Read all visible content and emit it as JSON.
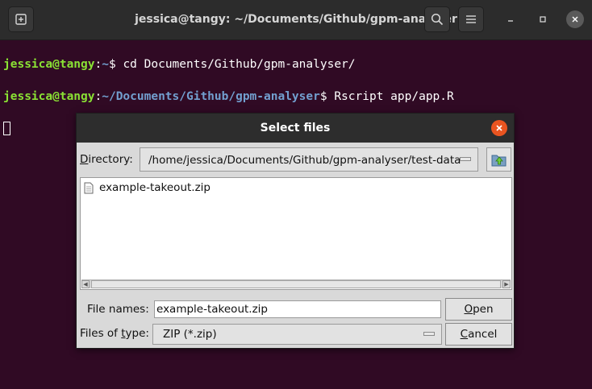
{
  "terminal": {
    "title": "jessica@tangy: ~/Documents/Github/gpm-analyser",
    "lines": [
      {
        "user": "jessica@tangy",
        "sep": ":",
        "path": "~",
        "prompt": "$ ",
        "command": "cd Documents/Github/gpm-analyser/"
      },
      {
        "user": "jessica@tangy",
        "sep": ":",
        "path": "~/Documents/Github/gpm-analyser",
        "prompt": "$ ",
        "command": "Rscript app/app.R"
      }
    ],
    "icons": {
      "new_tab": "new-tab-icon",
      "search": "search-icon",
      "menu": "hamburger-menu-icon",
      "minimize": "minimize-icon",
      "maximize": "maximize-icon",
      "close": "close-icon"
    }
  },
  "dialog": {
    "title": "Select files",
    "directory_label_prefix": "D",
    "directory_label_rest": "irectory:",
    "directory_value": "/home/jessica/Documents/Github/gpm-analyser/test-data",
    "files": [
      {
        "name": "example-takeout.zip",
        "icon": "file-icon"
      }
    ],
    "file_names_label": "File names:",
    "file_names_value": "example-takeout.zip",
    "files_of_type_label_a": "Files of ",
    "files_of_type_label_u": "t",
    "files_of_type_label_b": "ype:",
    "files_of_type_value": "ZIP (*.zip)",
    "open_label_u": "O",
    "open_label_rest": "pen",
    "cancel_label_u": "C",
    "cancel_label_rest": "ancel",
    "colors": {
      "close_button": "#e95420",
      "terminal_bg": "#300a24",
      "user_prompt": "#8ae234",
      "path_prompt": "#729fcf"
    }
  }
}
